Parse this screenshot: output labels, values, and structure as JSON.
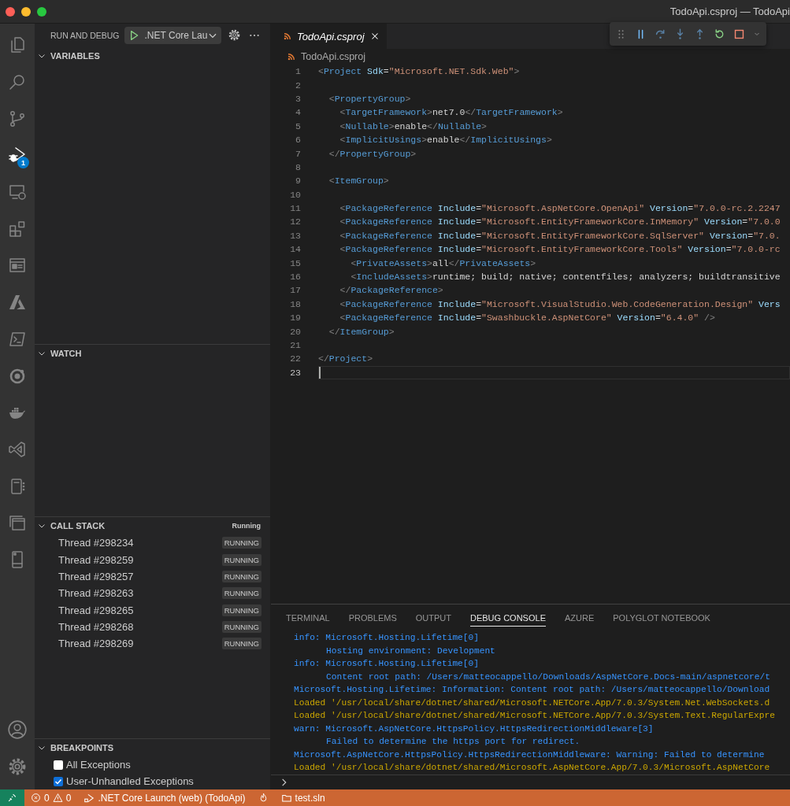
{
  "window": {
    "title": "TodoApi.csproj — TodoApi"
  },
  "activity_bar": {
    "items": [
      {
        "kind": "explorer",
        "selected": false
      },
      {
        "kind": "search",
        "selected": false
      },
      {
        "kind": "scm",
        "selected": false
      },
      {
        "kind": "debug",
        "selected": true,
        "badge": "1"
      },
      {
        "kind": "remote",
        "selected": false
      },
      {
        "kind": "extensions",
        "selected": false
      },
      {
        "kind": "browser",
        "selected": false
      },
      {
        "kind": "azure",
        "selected": false
      },
      {
        "kind": "terminal",
        "selected": false
      },
      {
        "kind": "ring",
        "selected": false
      },
      {
        "kind": "docker",
        "selected": false
      },
      {
        "kind": "vs",
        "selected": false
      },
      {
        "kind": "notebook",
        "selected": false
      },
      {
        "kind": "windows",
        "selected": false
      },
      {
        "kind": "device",
        "selected": false
      }
    ],
    "bottom": [
      {
        "kind": "account"
      },
      {
        "kind": "gear"
      }
    ]
  },
  "sidebar": {
    "title": "RUN AND DEBUG",
    "launch_config": ".NET Core Lau",
    "sections": [
      {
        "kind": "variables",
        "title": "VARIABLES",
        "expanded": true
      },
      {
        "kind": "watch",
        "title": "WATCH",
        "expanded": true
      },
      {
        "kind": "callstack",
        "title": "CALL STACK",
        "expanded": true,
        "status": "Running",
        "threads": [
          {
            "name": "Thread #298234",
            "state": "RUNNING"
          },
          {
            "name": "Thread #298259",
            "state": "RUNNING"
          },
          {
            "name": "Thread #298257",
            "state": "RUNNING"
          },
          {
            "name": "Thread #298263",
            "state": "RUNNING"
          },
          {
            "name": "Thread #298265",
            "state": "RUNNING"
          },
          {
            "name": "Thread #298268",
            "state": "RUNNING"
          },
          {
            "name": "Thread #298269",
            "state": "RUNNING"
          }
        ]
      },
      {
        "kind": "breakpoints",
        "title": "BREAKPOINTS",
        "expanded": true,
        "items": [
          {
            "label": "All Exceptions",
            "checked": false
          },
          {
            "label": "User-Unhandled Exceptions",
            "checked": true
          }
        ]
      }
    ]
  },
  "editor": {
    "tab": "TodoApi.csproj",
    "breadcrumb": "TodoApi.csproj",
    "lines": [
      {
        "number": "1",
        "current": false,
        "tokens": [
          {
            "kind": "punct",
            "text": "<"
          },
          {
            "kind": "tag",
            "text": "Project"
          },
          {
            "kind": "attr",
            "text": " Sdk"
          },
          {
            "kind": "plain",
            "text": "="
          },
          {
            "kind": "str",
            "text": "\"Microsoft.NET.Sdk.Web\""
          },
          {
            "kind": "punct",
            "text": ">"
          }
        ]
      },
      {
        "number": "2",
        "current": false
      },
      {
        "number": "3",
        "current": false,
        "tokens": [
          {
            "kind": "punct",
            "text": "  <"
          },
          {
            "kind": "tag",
            "text": "PropertyGroup"
          },
          {
            "kind": "punct",
            "text": ">"
          }
        ]
      },
      {
        "number": "4",
        "current": false,
        "tokens": [
          {
            "kind": "punct",
            "text": "    <"
          },
          {
            "kind": "tag",
            "text": "TargetFramework"
          },
          {
            "kind": "punct",
            "text": ">"
          },
          {
            "kind": "plain",
            "text": "net7.0"
          },
          {
            "kind": "punct",
            "text": "</"
          },
          {
            "kind": "tag",
            "text": "TargetFramework"
          },
          {
            "kind": "punct",
            "text": ">"
          }
        ]
      },
      {
        "number": "5",
        "current": false,
        "tokens": [
          {
            "kind": "punct",
            "text": "    <"
          },
          {
            "kind": "tag",
            "text": "Nullable"
          },
          {
            "kind": "punct",
            "text": ">"
          },
          {
            "kind": "plain",
            "text": "enable"
          },
          {
            "kind": "punct",
            "text": "</"
          },
          {
            "kind": "tag",
            "text": "Nullable"
          },
          {
            "kind": "punct",
            "text": ">"
          }
        ]
      },
      {
        "number": "6",
        "current": false,
        "tokens": [
          {
            "kind": "punct",
            "text": "    <"
          },
          {
            "kind": "tag",
            "text": "ImplicitUsings"
          },
          {
            "kind": "punct",
            "text": ">"
          },
          {
            "kind": "plain",
            "text": "enable"
          },
          {
            "kind": "punct",
            "text": "</"
          },
          {
            "kind": "tag",
            "text": "ImplicitUsings"
          },
          {
            "kind": "punct",
            "text": ">"
          }
        ]
      },
      {
        "number": "7",
        "current": false,
        "tokens": [
          {
            "kind": "punct",
            "text": "  </"
          },
          {
            "kind": "tag",
            "text": "PropertyGroup"
          },
          {
            "kind": "punct",
            "text": ">"
          }
        ]
      },
      {
        "number": "8",
        "current": false
      },
      {
        "number": "9",
        "current": false,
        "tokens": [
          {
            "kind": "punct",
            "text": "  <"
          },
          {
            "kind": "tag",
            "text": "ItemGroup"
          },
          {
            "kind": "punct",
            "text": ">"
          }
        ]
      },
      {
        "number": "10",
        "current": false
      },
      {
        "number": "11",
        "current": false,
        "tokens": [
          {
            "kind": "punct",
            "text": "    <"
          },
          {
            "kind": "tag",
            "text": "PackageReference"
          },
          {
            "kind": "attr",
            "text": " Include"
          },
          {
            "kind": "plain",
            "text": "="
          },
          {
            "kind": "str",
            "text": "\"Microsoft.AspNetCore.OpenApi\""
          },
          {
            "kind": "attr",
            "text": " Version"
          },
          {
            "kind": "plain",
            "text": "="
          },
          {
            "kind": "str",
            "text": "\"7.0.0-rc.2.2247"
          }
        ]
      },
      {
        "number": "12",
        "current": false,
        "tokens": [
          {
            "kind": "punct",
            "text": "    <"
          },
          {
            "kind": "tag",
            "text": "PackageReference"
          },
          {
            "kind": "attr",
            "text": " Include"
          },
          {
            "kind": "plain",
            "text": "="
          },
          {
            "kind": "str",
            "text": "\"Microsoft.EntityFrameworkCore.InMemory\""
          },
          {
            "kind": "attr",
            "text": " Version"
          },
          {
            "kind": "plain",
            "text": "="
          },
          {
            "kind": "str",
            "text": "\"7.0.0"
          }
        ]
      },
      {
        "number": "13",
        "current": false,
        "tokens": [
          {
            "kind": "punct",
            "text": "    <"
          },
          {
            "kind": "tag",
            "text": "PackageReference"
          },
          {
            "kind": "attr",
            "text": " Include"
          },
          {
            "kind": "plain",
            "text": "="
          },
          {
            "kind": "str",
            "text": "\"Microsoft.EntityFrameworkCore.SqlServer\""
          },
          {
            "kind": "attr",
            "text": " Version"
          },
          {
            "kind": "plain",
            "text": "="
          },
          {
            "kind": "str",
            "text": "\"7.0."
          }
        ]
      },
      {
        "number": "14",
        "current": false,
        "tokens": [
          {
            "kind": "punct",
            "text": "    <"
          },
          {
            "kind": "tag",
            "text": "PackageReference"
          },
          {
            "kind": "attr",
            "text": " Include"
          },
          {
            "kind": "plain",
            "text": "="
          },
          {
            "kind": "str",
            "text": "\"Microsoft.EntityFrameworkCore.Tools\""
          },
          {
            "kind": "attr",
            "text": " Version"
          },
          {
            "kind": "plain",
            "text": "="
          },
          {
            "kind": "str",
            "text": "\"7.0.0-rc"
          }
        ]
      },
      {
        "number": "15",
        "current": false,
        "tokens": [
          {
            "kind": "punct",
            "text": "      <"
          },
          {
            "kind": "tag",
            "text": "PrivateAssets"
          },
          {
            "kind": "punct",
            "text": ">"
          },
          {
            "kind": "plain",
            "text": "all"
          },
          {
            "kind": "punct",
            "text": "</"
          },
          {
            "kind": "tag",
            "text": "PrivateAssets"
          },
          {
            "kind": "punct",
            "text": ">"
          }
        ]
      },
      {
        "number": "16",
        "current": false,
        "tokens": [
          {
            "kind": "punct",
            "text": "      <"
          },
          {
            "kind": "tag",
            "text": "IncludeAssets"
          },
          {
            "kind": "punct",
            "text": ">"
          },
          {
            "kind": "plain",
            "text": "runtime; build; native; contentfiles; analyzers; buildtransitive"
          }
        ]
      },
      {
        "number": "17",
        "current": false,
        "tokens": [
          {
            "kind": "punct",
            "text": "    </"
          },
          {
            "kind": "tag",
            "text": "PackageReference"
          },
          {
            "kind": "punct",
            "text": ">"
          }
        ]
      },
      {
        "number": "18",
        "current": false,
        "tokens": [
          {
            "kind": "punct",
            "text": "    <"
          },
          {
            "kind": "tag",
            "text": "PackageReference"
          },
          {
            "kind": "attr",
            "text": " Include"
          },
          {
            "kind": "plain",
            "text": "="
          },
          {
            "kind": "str",
            "text": "\"Microsoft.VisualStudio.Web.CodeGeneration.Design\""
          },
          {
            "kind": "attr",
            "text": " Vers"
          }
        ]
      },
      {
        "number": "19",
        "current": false,
        "tokens": [
          {
            "kind": "punct",
            "text": "    <"
          },
          {
            "kind": "tag",
            "text": "PackageReference"
          },
          {
            "kind": "attr",
            "text": " Include"
          },
          {
            "kind": "plain",
            "text": "="
          },
          {
            "kind": "str",
            "text": "\"Swashbuckle.AspNetCore\""
          },
          {
            "kind": "attr",
            "text": " Version"
          },
          {
            "kind": "plain",
            "text": "="
          },
          {
            "kind": "str",
            "text": "\"6.4.0\""
          },
          {
            "kind": "punct",
            "text": " />"
          }
        ]
      },
      {
        "number": "20",
        "current": false,
        "tokens": [
          {
            "kind": "punct",
            "text": "  </"
          },
          {
            "kind": "tag",
            "text": "ItemGroup"
          },
          {
            "kind": "punct",
            "text": ">"
          }
        ]
      },
      {
        "number": "21",
        "current": false
      },
      {
        "number": "22",
        "current": false,
        "tokens": [
          {
            "kind": "punct",
            "text": "</"
          },
          {
            "kind": "tag",
            "text": "Project"
          },
          {
            "kind": "punct",
            "text": ">"
          }
        ]
      },
      {
        "number": "23",
        "current": true
      }
    ]
  },
  "panel": {
    "tabs": [
      {
        "label": "TERMINAL",
        "selected": false
      },
      {
        "label": "PROBLEMS",
        "selected": false
      },
      {
        "label": "OUTPUT",
        "selected": false
      },
      {
        "label": "DEBUG CONSOLE",
        "selected": true
      },
      {
        "label": "AZURE",
        "selected": false
      },
      {
        "label": "POLYGLOT NOTEBOOK",
        "selected": false
      }
    ],
    "console": [
      {
        "kind": "info",
        "indent": false,
        "text": "info: Microsoft.Hosting.Lifetime[0]"
      },
      {
        "kind": "info",
        "indent": true,
        "text": "Hosting environment: Development"
      },
      {
        "kind": "info",
        "indent": false,
        "text": "info: Microsoft.Hosting.Lifetime[0]"
      },
      {
        "kind": "info",
        "indent": true,
        "text": "Content root path: /Users/matteocappello/Downloads/AspNetCore.Docs-main/aspnetcore/t"
      },
      {
        "kind": "info",
        "indent": false,
        "text": "Microsoft.Hosting.Lifetime: Information: Content root path: /Users/matteocappello/Download"
      },
      {
        "kind": "load",
        "indent": false,
        "text": "Loaded '/usr/local/share/dotnet/shared/Microsoft.NETCore.App/7.0.3/System.Net.WebSockets.d"
      },
      {
        "kind": "load",
        "indent": false,
        "text": "Loaded '/usr/local/share/dotnet/shared/Microsoft.NETCore.App/7.0.3/System.Text.RegularExpre"
      },
      {
        "kind": "info",
        "indent": false,
        "text": "warn: Microsoft.AspNetCore.HttpsPolicy.HttpsRedirectionMiddleware[3]"
      },
      {
        "kind": "info",
        "indent": true,
        "text": "Failed to determine the https port for redirect."
      },
      {
        "kind": "info",
        "indent": false,
        "text": "Microsoft.AspNetCore.HttpsPolicy.HttpsRedirectionMiddleware: Warning: Failed to determine"
      },
      {
        "kind": "load",
        "indent": false,
        "text": "Loaded '/usr/local/share/dotnet/shared/Microsoft.AspNetCore.App/7.0.3/Microsoft.AspNetCore"
      }
    ]
  },
  "status_bar": {
    "errors": "0",
    "warnings": "0",
    "launch": ".NET Core Launch (web) (TodoApi)",
    "workspace": "test.sln"
  }
}
